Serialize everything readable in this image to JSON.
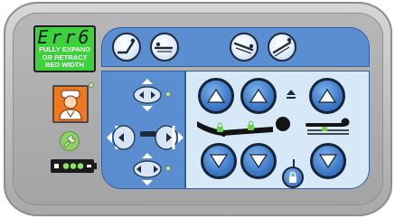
{
  "display": {
    "error_code": "Err6",
    "lines": [
      "FULLY EXPAND",
      "OR RETRACT",
      "BED WIDTH"
    ]
  },
  "colors": {
    "display_bg": "#3dd23d",
    "panel_blue": "#5a8ed0",
    "light_blue": "#d7e9f7",
    "nurse_orange": "#f0781e",
    "led_green": "#8fd064"
  },
  "icons": {
    "top_left": [
      "head-up-icon",
      "flat-icon"
    ],
    "top_right": [
      "trendelenburg-icon",
      "reverse-trendelenburg-icon"
    ],
    "width_controls": [
      "bed-narrow-icon",
      "bed-retract-icon",
      "bed-expand-icon",
      "bed-wide-icon"
    ],
    "main": [
      "head-up-arrow",
      "foot-up-arrow",
      "bed-up-arrow",
      "head-down-arrow",
      "foot-down-arrow",
      "bed-down-arrow"
    ],
    "misc": [
      "nurse-call-icon",
      "wrench-icon",
      "battery-icon",
      "lock-icon",
      "eject-icon",
      "patient-icon",
      "bed-height-icon"
    ]
  }
}
